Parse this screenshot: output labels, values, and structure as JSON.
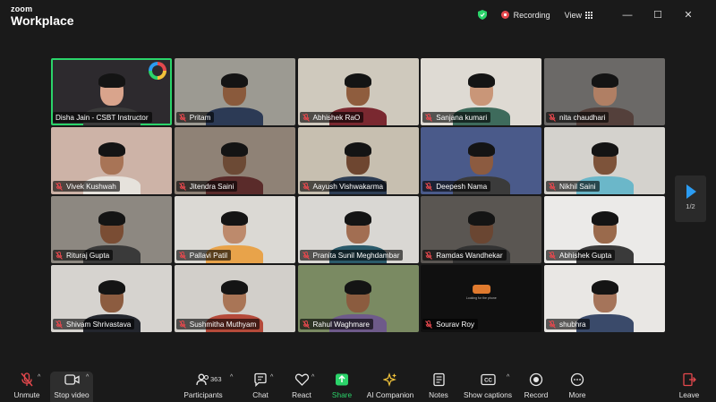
{
  "titlebar": {
    "brand_top": "zoom",
    "brand_bottom": "Workplace",
    "recording_label": "Recording",
    "view_label": "View",
    "minimize": "—",
    "maximize": "☐",
    "close": "✕"
  },
  "participants": [
    {
      "name": "Disha Jain - CSBT Instructor",
      "bg": "#2d2a2e",
      "skin": "#d9a48c",
      "shirt": "#3b3b3b",
      "muted": false,
      "active": true
    },
    {
      "name": "Pritam",
      "bg": "#9c9a92",
      "skin": "#8a5a3c",
      "shirt": "#2c3a55",
      "muted": true
    },
    {
      "name": "Abhishek RaO",
      "bg": "#cfc9bd",
      "skin": "#8f5d3e",
      "shirt": "#7a2830",
      "muted": true
    },
    {
      "name": "Sanjana kumari",
      "bg": "#dedad3",
      "skin": "#c99678",
      "shirt": "#3e6b5c",
      "muted": true
    },
    {
      "name": "nita chaudhari",
      "bg": "#6b6967",
      "skin": "#b07f64",
      "shirt": "#54403b",
      "muted": true
    },
    {
      "name": "Vivek Kushwah",
      "bg": "#cdb3a7",
      "skin": "#a87456",
      "shirt": "#e6e2dc",
      "muted": true
    },
    {
      "name": "Jitendra Saini",
      "bg": "#8f8276",
      "skin": "#6c4a35",
      "shirt": "#5a2b2a",
      "muted": true
    },
    {
      "name": "Aayush Vishwakarma",
      "bg": "#c7bfb0",
      "skin": "#6e4630",
      "shirt": "#2e3e55",
      "muted": true
    },
    {
      "name": "Deepesh Nama",
      "bg": "#4a5a8a",
      "skin": "#8c5b40",
      "shirt": "#3b3b3b",
      "muted": true
    },
    {
      "name": "Nikhil Saini",
      "bg": "#d4d2cd",
      "skin": "#7d533a",
      "shirt": "#6bb7c9",
      "muted": true
    },
    {
      "name": "Rituraj Gupta",
      "bg": "#8d8881",
      "skin": "#7a4d34",
      "shirt": "#3a3a3a",
      "muted": true
    },
    {
      "name": "Pallavi Patil",
      "bg": "#dbd9d4",
      "skin": "#bd8a6c",
      "shirt": "#e8a34a",
      "muted": true
    },
    {
      "name": "Pranita Sunil Meghdambar",
      "bg": "#d9d7d3",
      "skin": "#a26e52",
      "shirt": "#2a5a6a",
      "muted": true
    },
    {
      "name": "Ramdas Wandhekar",
      "bg": "#5a5652",
      "skin": "#6a4632",
      "shirt": "#333333",
      "muted": true
    },
    {
      "name": "Abhishek Gupta",
      "bg": "#ebeae8",
      "skin": "#9a6a4c",
      "shirt": "#3a3a3a",
      "muted": true
    },
    {
      "name": "Shivam Shrivastava",
      "bg": "#d6d3cf",
      "skin": "#8c5c40",
      "shirt": "#23262d",
      "muted": true
    },
    {
      "name": "Sushmitha Muthyam",
      "bg": "#d2cfca",
      "skin": "#a97556",
      "shirt": "#b54a3a",
      "muted": true
    },
    {
      "name": "Rahul Waghmare",
      "bg": "#7a8a62",
      "skin": "#8b5c3f",
      "shirt": "#6e5a8a",
      "muted": true
    },
    {
      "name": "Sourav Roy",
      "bg": "#101010",
      "skin": "#101010",
      "shirt": "#101010",
      "muted": true,
      "no_video": true,
      "caption": "Looking for the phone"
    },
    {
      "name": "shubhra",
      "bg": "#e9e7e4",
      "skin": "#a5745a",
      "shirt": "#3a4a6a",
      "muted": true
    }
  ],
  "pager": {
    "page": "1/2"
  },
  "toolbar": {
    "unmute": "Unmute",
    "stop_video": "Stop video",
    "participants": "Participants",
    "participants_count": "363",
    "chat": "Chat",
    "react": "React",
    "share": "Share",
    "ai_companion": "AI Companion",
    "notes": "Notes",
    "show_captions": "Show captions",
    "record": "Record",
    "more": "More",
    "leave": "Leave"
  },
  "colors": {
    "active_speaker": "#2bd46a",
    "share_green": "#2bd46a",
    "leave_red": "#e5484d",
    "muted_red": "#e5484d",
    "pager_blue": "#2b9cf2"
  }
}
